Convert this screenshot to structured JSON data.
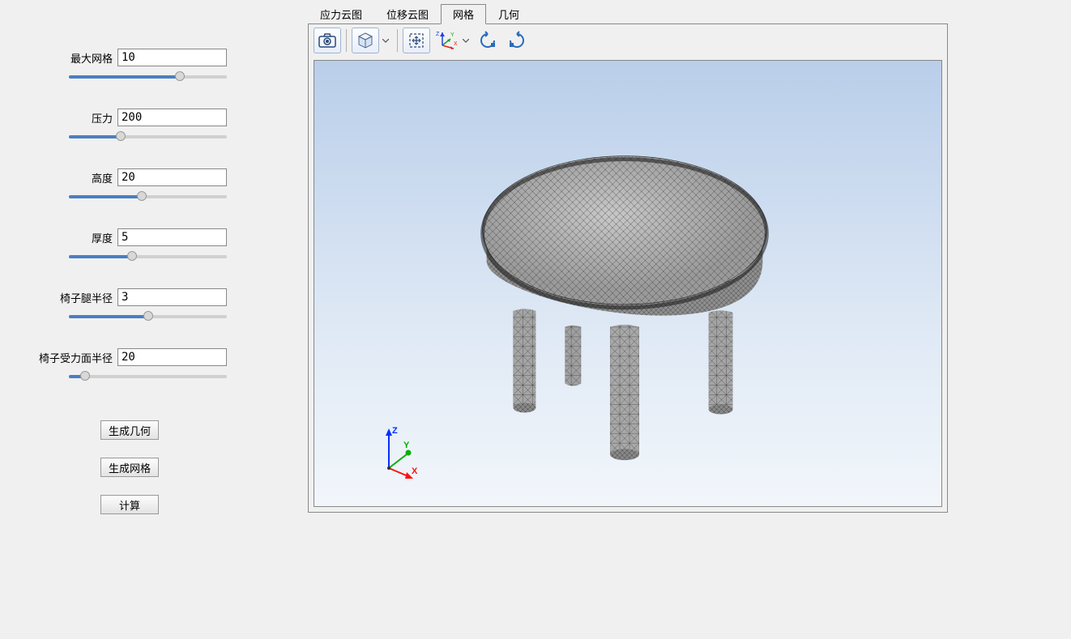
{
  "sidebar": {
    "params": [
      {
        "label": "最大网格",
        "value": "10",
        "fill": 70
      },
      {
        "label": "压力",
        "value": "200",
        "fill": 33
      },
      {
        "label": "高度",
        "value": "20",
        "fill": 46
      },
      {
        "label": "厚度",
        "value": "5",
        "fill": 40
      },
      {
        "label": "椅子腿半径",
        "value": "3",
        "fill": 50
      },
      {
        "label": "椅子受力面半径",
        "value": "20",
        "fill": 10
      }
    ],
    "buttons": {
      "gen_geom": "生成几何",
      "gen_mesh": "生成网格",
      "calc": "计算"
    }
  },
  "tabs": [
    {
      "label": "应力云图",
      "active": false
    },
    {
      "label": "位移云图",
      "active": false
    },
    {
      "label": "网格",
      "active": true
    },
    {
      "label": "几何",
      "active": false
    }
  ],
  "axis": {
    "x": "X",
    "y": "Y",
    "z": "Z"
  },
  "toolbar_axis": {
    "x": "X",
    "y": "Y",
    "z": "Z"
  }
}
